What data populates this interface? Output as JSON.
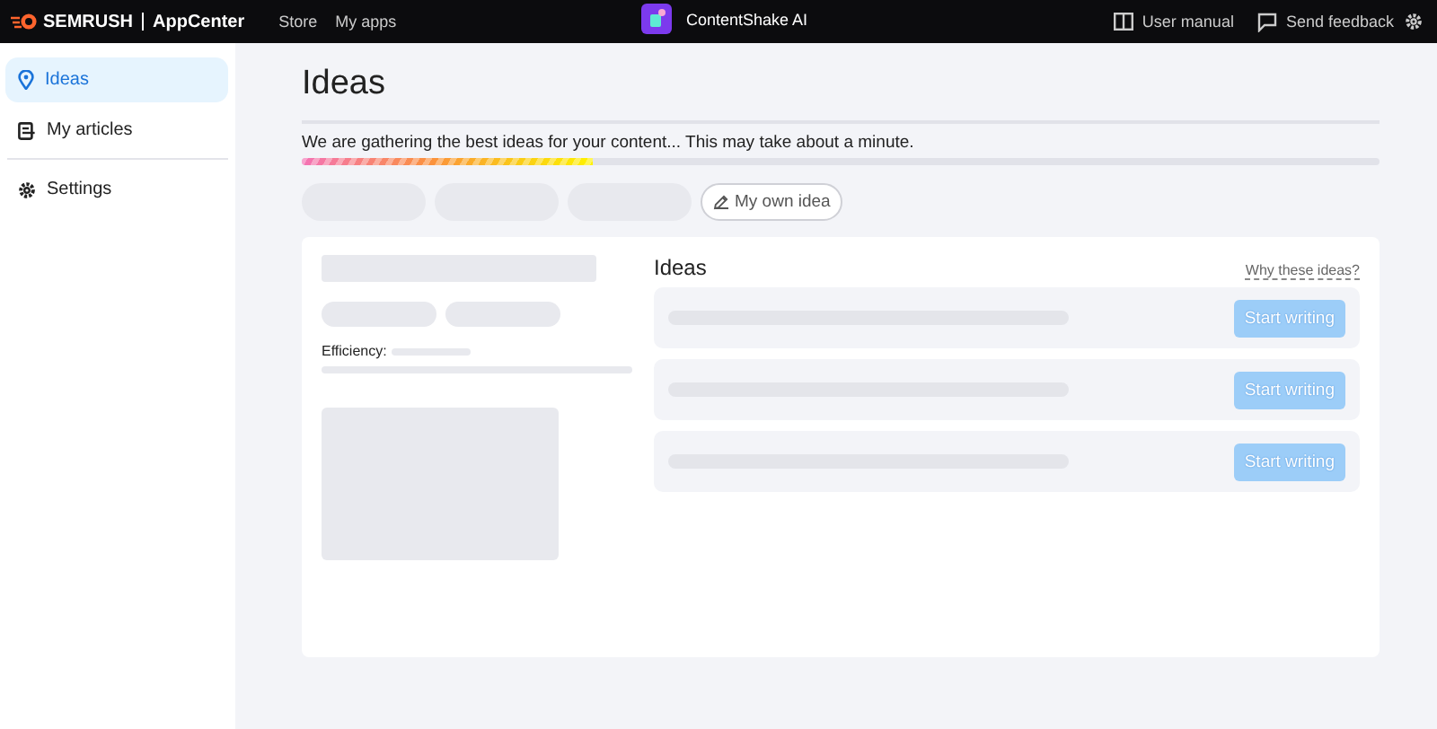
{
  "topbar": {
    "brand": "SEMRUSH",
    "app_center": "AppCenter",
    "nav": [
      {
        "label": "Store"
      },
      {
        "label": "My apps"
      }
    ],
    "app_name": "ContentShake AI",
    "links": [
      {
        "label": "User manual",
        "kind": "book"
      },
      {
        "label": "Send feedback",
        "kind": "chat"
      }
    ]
  },
  "sidebar": {
    "items": [
      {
        "label": "Ideas",
        "kind": "pin",
        "selected": true
      },
      {
        "label": "My articles",
        "kind": "doc",
        "selected": false
      },
      {
        "label": "Settings",
        "kind": "gear",
        "selected": false
      }
    ]
  },
  "page": {
    "title": "Ideas",
    "status": "We are gathering the best ideas for your content... This may take about a minute.",
    "progress": {
      "level": 0.27
    },
    "own_idea_button": "My own idea",
    "details": {
      "efficiency_label": "Efficiency:"
    },
    "ideas": {
      "title": "Ideas",
      "why_link": "Why these ideas?",
      "items": [
        {
          "button": "Start writing",
          "disabled": true
        },
        {
          "button": "Start writing",
          "disabled": true
        },
        {
          "button": "Start writing",
          "disabled": true
        }
      ]
    }
  }
}
